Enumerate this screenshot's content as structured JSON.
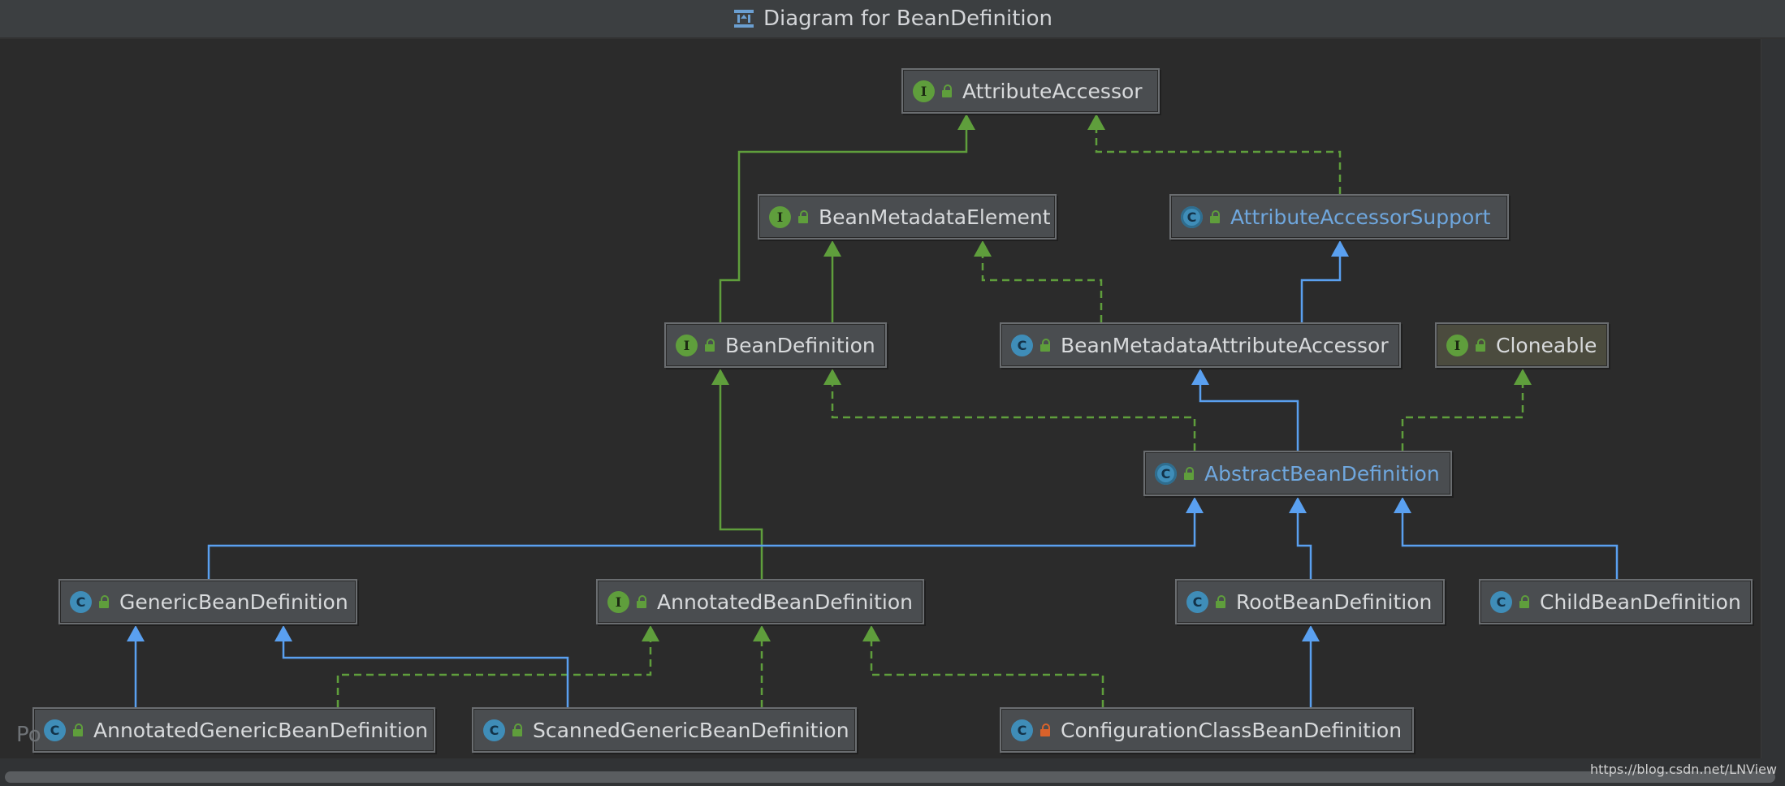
{
  "window": {
    "title": "Diagram for BeanDefinition"
  },
  "watermark": "https://blog.csdn.net/LNView",
  "cut_label": "Po",
  "colors": {
    "inherit_interface": "#5f9e3c",
    "extends_class": "#5aa0f0",
    "interface_badge": "#5f9e3c",
    "class_badge": "#3f8db8",
    "abstract_label": "#6fa7de"
  },
  "nodes": [
    {
      "id": "AttributeAccessor",
      "label": "AttributeAccessor",
      "kind": "interface",
      "icon": "interface-icon"
    },
    {
      "id": "BeanMetadataElement",
      "label": "BeanMetadataElement",
      "kind": "interface",
      "icon": "interface-icon"
    },
    {
      "id": "AttributeAccessorSupport",
      "label": "AttributeAccessorSupport",
      "kind": "abstract-class",
      "icon": "abstract-class-icon"
    },
    {
      "id": "BeanDefinition",
      "label": "BeanDefinition",
      "kind": "interface",
      "icon": "interface-icon"
    },
    {
      "id": "BeanMetadataAttributeAccessor",
      "label": "BeanMetadataAttributeAccessor",
      "kind": "class",
      "icon": "class-icon"
    },
    {
      "id": "Cloneable",
      "label": "Cloneable",
      "kind": "interface",
      "icon": "interface-icon"
    },
    {
      "id": "AbstractBeanDefinition",
      "label": "AbstractBeanDefinition",
      "kind": "abstract-class",
      "icon": "abstract-class-icon"
    },
    {
      "id": "GenericBeanDefinition",
      "label": "GenericBeanDefinition",
      "kind": "class",
      "icon": "class-icon"
    },
    {
      "id": "AnnotatedBeanDefinition",
      "label": "AnnotatedBeanDefinition",
      "kind": "interface",
      "icon": "interface-icon"
    },
    {
      "id": "RootBeanDefinition",
      "label": "RootBeanDefinition",
      "kind": "class",
      "icon": "class-icon"
    },
    {
      "id": "ChildBeanDefinition",
      "label": "ChildBeanDefinition",
      "kind": "class",
      "icon": "class-icon"
    },
    {
      "id": "AnnotatedGenericBeanDefinition",
      "label": "AnnotatedGenericBeanDefinition",
      "kind": "class",
      "icon": "class-icon"
    },
    {
      "id": "ScannedGenericBeanDefinition",
      "label": "ScannedGenericBeanDefinition",
      "kind": "class",
      "icon": "class-icon"
    },
    {
      "id": "ConfigurationClassBeanDefinition",
      "label": "ConfigurationClassBeanDefinition",
      "kind": "class",
      "icon": "class-icon",
      "access": "private"
    }
  ],
  "edges": [
    {
      "from": "BeanDefinition",
      "to": "AttributeAccessor",
      "type": "extends-interface"
    },
    {
      "from": "AttributeAccessorSupport",
      "to": "AttributeAccessor",
      "type": "implements"
    },
    {
      "from": "BeanDefinition",
      "to": "BeanMetadataElement",
      "type": "extends-interface"
    },
    {
      "from": "BeanMetadataAttributeAccessor",
      "to": "BeanMetadataElement",
      "type": "implements"
    },
    {
      "from": "BeanMetadataAttributeAccessor",
      "to": "AttributeAccessorSupport",
      "type": "extends-class"
    },
    {
      "from": "AbstractBeanDefinition",
      "to": "BeanMetadataAttributeAccessor",
      "type": "extends-class"
    },
    {
      "from": "AbstractBeanDefinition",
      "to": "BeanDefinition",
      "type": "implements"
    },
    {
      "from": "AbstractBeanDefinition",
      "to": "Cloneable",
      "type": "implements"
    },
    {
      "from": "AnnotatedBeanDefinition",
      "to": "BeanDefinition",
      "type": "extends-interface"
    },
    {
      "from": "GenericBeanDefinition",
      "to": "AbstractBeanDefinition",
      "type": "extends-class"
    },
    {
      "from": "RootBeanDefinition",
      "to": "AbstractBeanDefinition",
      "type": "extends-class"
    },
    {
      "from": "ChildBeanDefinition",
      "to": "AbstractBeanDefinition",
      "type": "extends-class"
    },
    {
      "from": "AnnotatedGenericBeanDefinition",
      "to": "GenericBeanDefinition",
      "type": "extends-class"
    },
    {
      "from": "AnnotatedGenericBeanDefinition",
      "to": "AnnotatedBeanDefinition",
      "type": "implements"
    },
    {
      "from": "ScannedGenericBeanDefinition",
      "to": "GenericBeanDefinition",
      "type": "extends-class"
    },
    {
      "from": "ScannedGenericBeanDefinition",
      "to": "AnnotatedBeanDefinition",
      "type": "implements"
    },
    {
      "from": "ConfigurationClassBeanDefinition",
      "to": "RootBeanDefinition",
      "type": "extends-class"
    },
    {
      "from": "ConfigurationClassBeanDefinition",
      "to": "AnnotatedBeanDefinition",
      "type": "implements"
    }
  ]
}
